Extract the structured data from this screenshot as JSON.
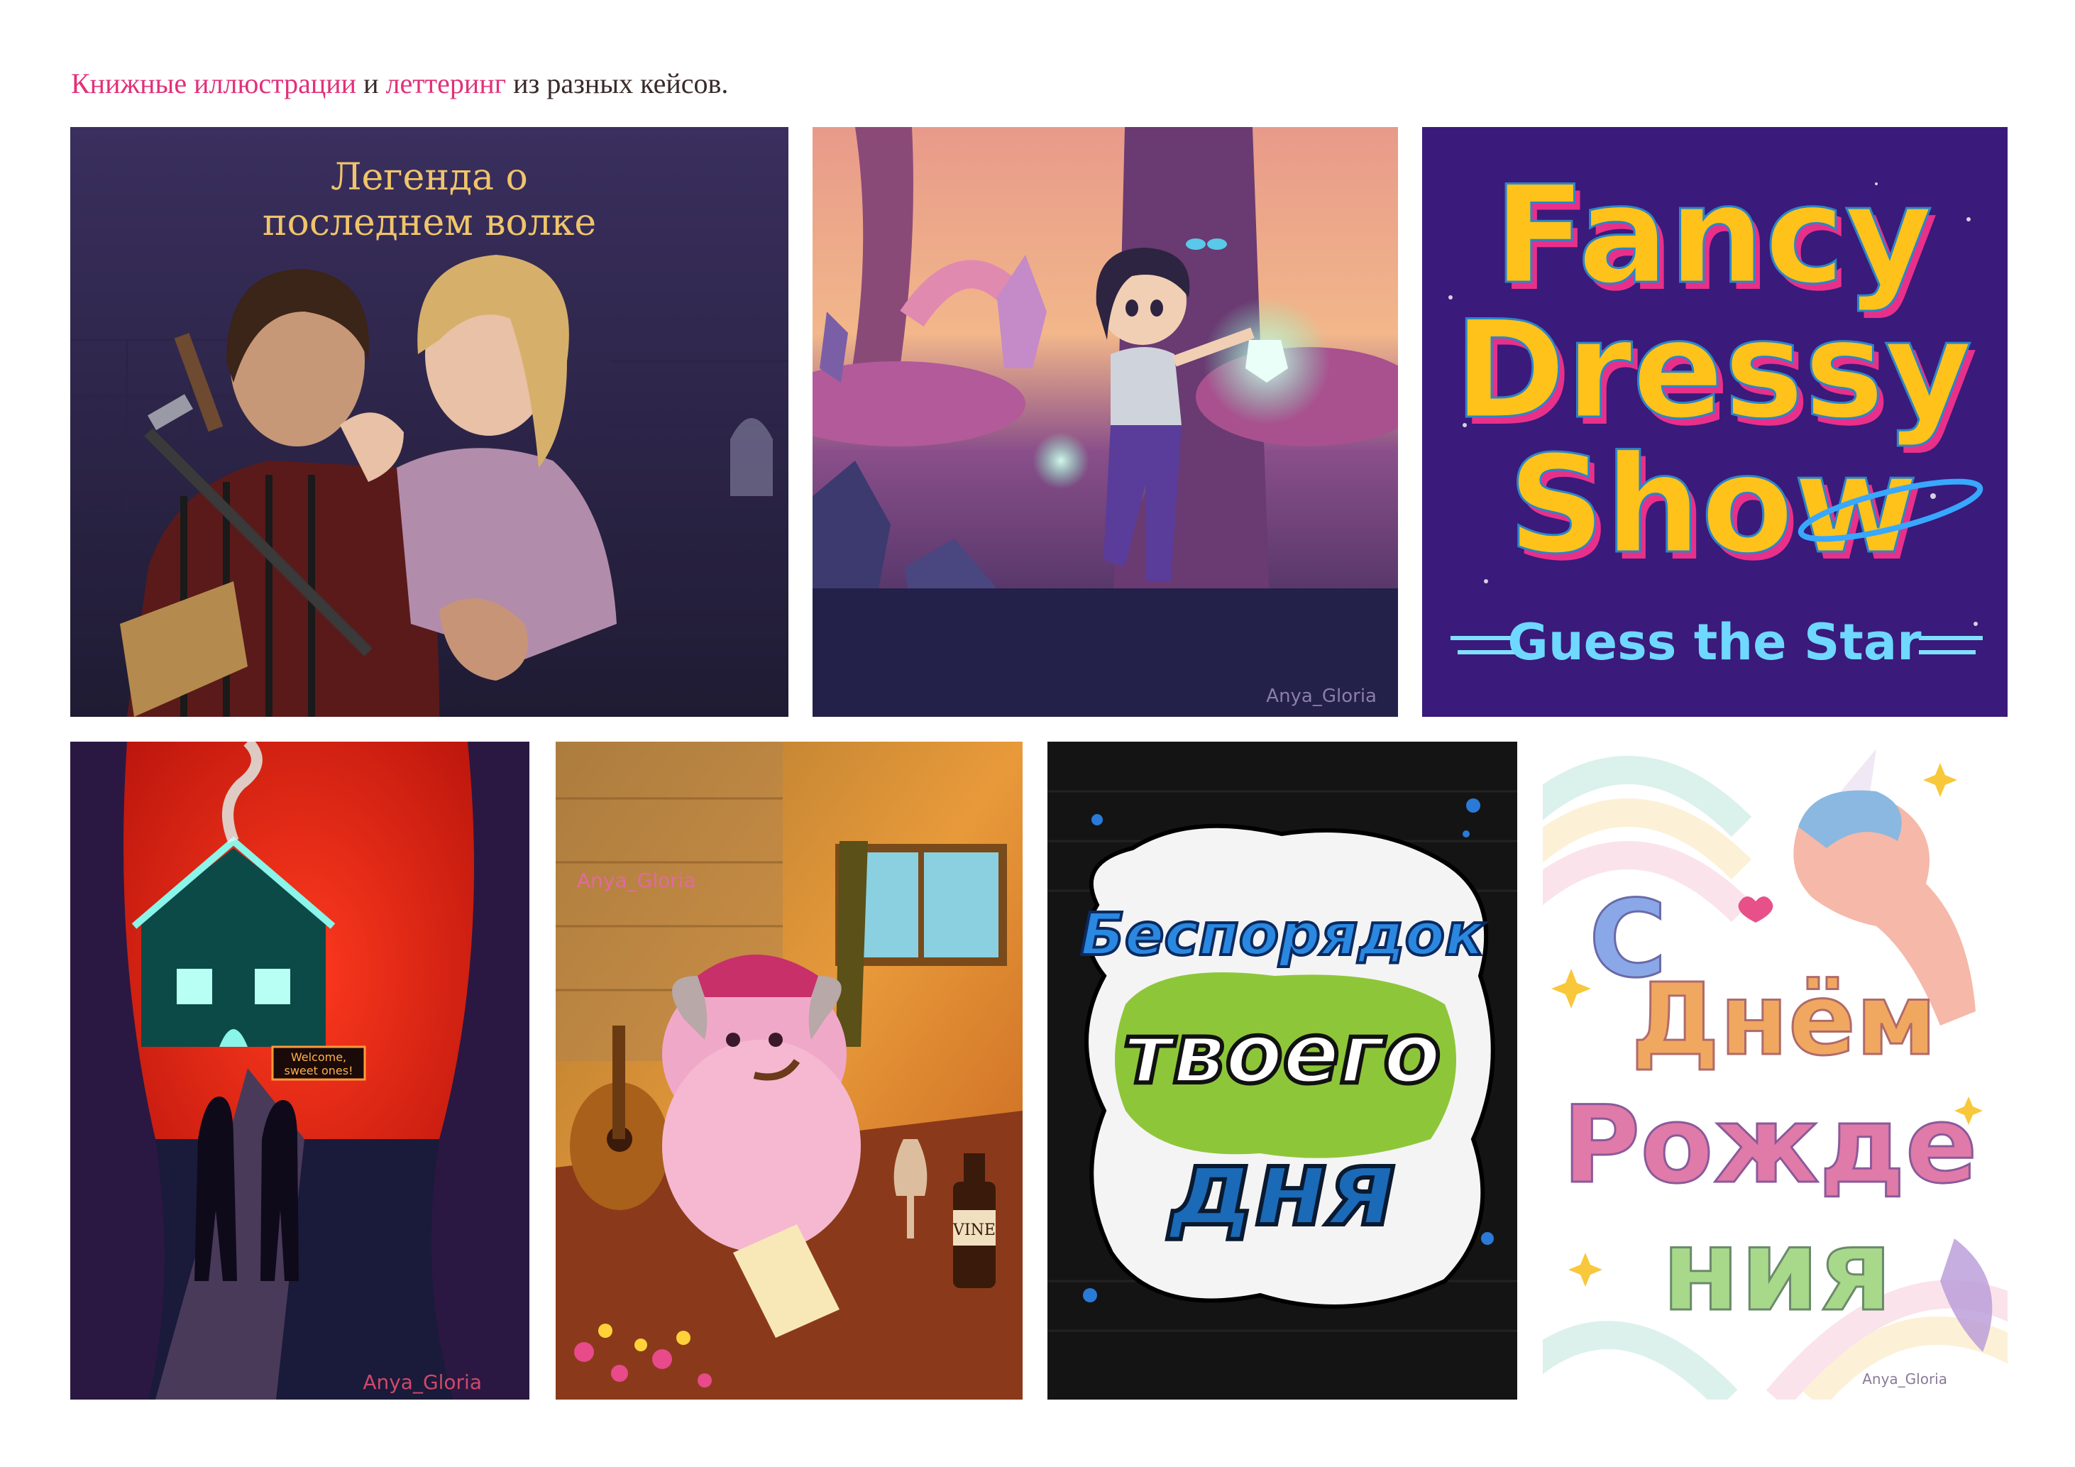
{
  "caption": {
    "part1": "Книжные иллюстрации",
    "part2": " и ",
    "part3": "леттеринг",
    "part4": " из разных кейсов."
  },
  "colors": {
    "accent": "#e2307a",
    "text": "#3a2a2a"
  },
  "gallery": {
    "wolf": {
      "title_line1": "Легенда о",
      "title_line2": "последнем волке"
    },
    "forest": {
      "signature": "Anya_Gloria"
    },
    "fancy": {
      "line1": "Fancy",
      "line2": "Dressy",
      "line3": "Show",
      "tagline": "Guess the Star"
    },
    "gingerbread": {
      "sign_line1": "Welcome,",
      "sign_line2": "sweet ones!",
      "signature": "Anya_Gloria"
    },
    "sheep": {
      "signature": "Anya_Gloria",
      "bottle_label": "VINE"
    },
    "graffiti": {
      "line1": "Беспорядок",
      "line2": "твоего",
      "line3": "дня"
    },
    "unicorn": {
      "line1": "С",
      "line2": "Днём",
      "line3": "Рожде",
      "line4": "ния",
      "signature": "Anya_Gloria"
    }
  }
}
